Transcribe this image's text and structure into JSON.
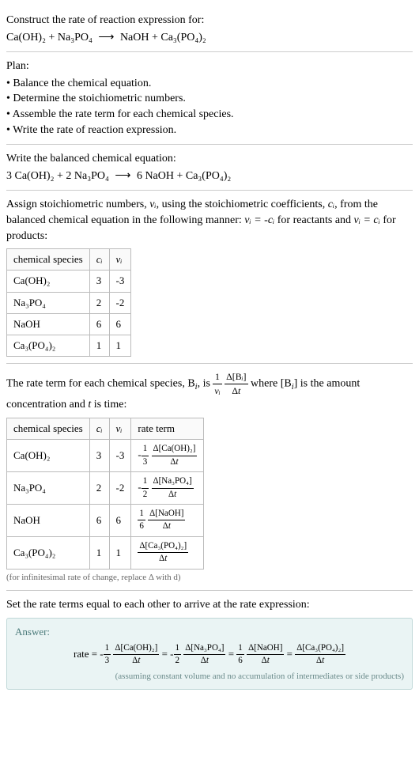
{
  "header": {
    "title": "Construct the rate of reaction expression for:",
    "equation_lhs": "Ca(OH)₂ + Na₃PO₄",
    "equation_rhs": "NaOH + Ca₃(PO₄)₂"
  },
  "plan": {
    "title": "Plan:",
    "items": [
      "Balance the chemical equation.",
      "Determine the stoichiometric numbers.",
      "Assemble the rate term for each chemical species.",
      "Write the rate of reaction expression."
    ]
  },
  "balanced": {
    "title": "Write the balanced chemical equation:",
    "equation_lhs": "3 Ca(OH)₂ + 2 Na₃PO₄",
    "equation_rhs": "6 NaOH + Ca₃(PO₄)₂"
  },
  "stoich": {
    "intro_1": "Assign stoichiometric numbers, ",
    "intro_2": ", using the stoichiometric coefficients, ",
    "intro_3": ", from the balanced chemical equation in the following manner: ",
    "intro_4": " for reactants and ",
    "intro_5": " for products:",
    "nu_i": "νᵢ",
    "c_i": "cᵢ",
    "rel1": "νᵢ = -cᵢ",
    "rel2": "νᵢ = cᵢ",
    "headers": [
      "chemical species",
      "cᵢ",
      "νᵢ"
    ],
    "rows": [
      {
        "species": "Ca(OH)₂",
        "c": "3",
        "nu": "-3"
      },
      {
        "species": "Na₃PO₄",
        "c": "2",
        "nu": "-2"
      },
      {
        "species": "NaOH",
        "c": "6",
        "nu": "6"
      },
      {
        "species": "Ca₃(PO₄)₂",
        "c": "1",
        "nu": "1"
      }
    ]
  },
  "rateterm": {
    "intro_1": "The rate term for each chemical species, B",
    "intro_2": ", is ",
    "intro_3": " where [B",
    "intro_4": "] is the amount concentration and ",
    "intro_5": " is time:",
    "sub_i": "i",
    "t": "t",
    "headers": [
      "chemical species",
      "cᵢ",
      "νᵢ",
      "rate term"
    ],
    "rows": [
      {
        "species": "Ca(OH)₂",
        "c": "3",
        "nu": "-3",
        "coef_num": "1",
        "coef_den": "3",
        "sign": "-",
        "delta": "Δ[Ca(OH)₂]"
      },
      {
        "species": "Na₃PO₄",
        "c": "2",
        "nu": "-2",
        "coef_num": "1",
        "coef_den": "2",
        "sign": "-",
        "delta": "Δ[Na₃PO₄]"
      },
      {
        "species": "NaOH",
        "c": "6",
        "nu": "6",
        "coef_num": "1",
        "coef_den": "6",
        "sign": "",
        "delta": "Δ[NaOH]"
      },
      {
        "species": "Ca₃(PO₄)₂",
        "c": "1",
        "nu": "1",
        "coef_num": "",
        "coef_den": "",
        "sign": "",
        "delta": "Δ[Ca₃(PO₄)₂]"
      }
    ],
    "dt": "Δt",
    "note": "(for infinitesimal rate of change, replace Δ with d)"
  },
  "final": {
    "title": "Set the rate terms equal to each other to arrive at the rate expression:",
    "answer_label": "Answer:",
    "rate_label": "rate",
    "disclaimer": "(assuming constant volume and no accumulation of intermediates or side products)"
  }
}
